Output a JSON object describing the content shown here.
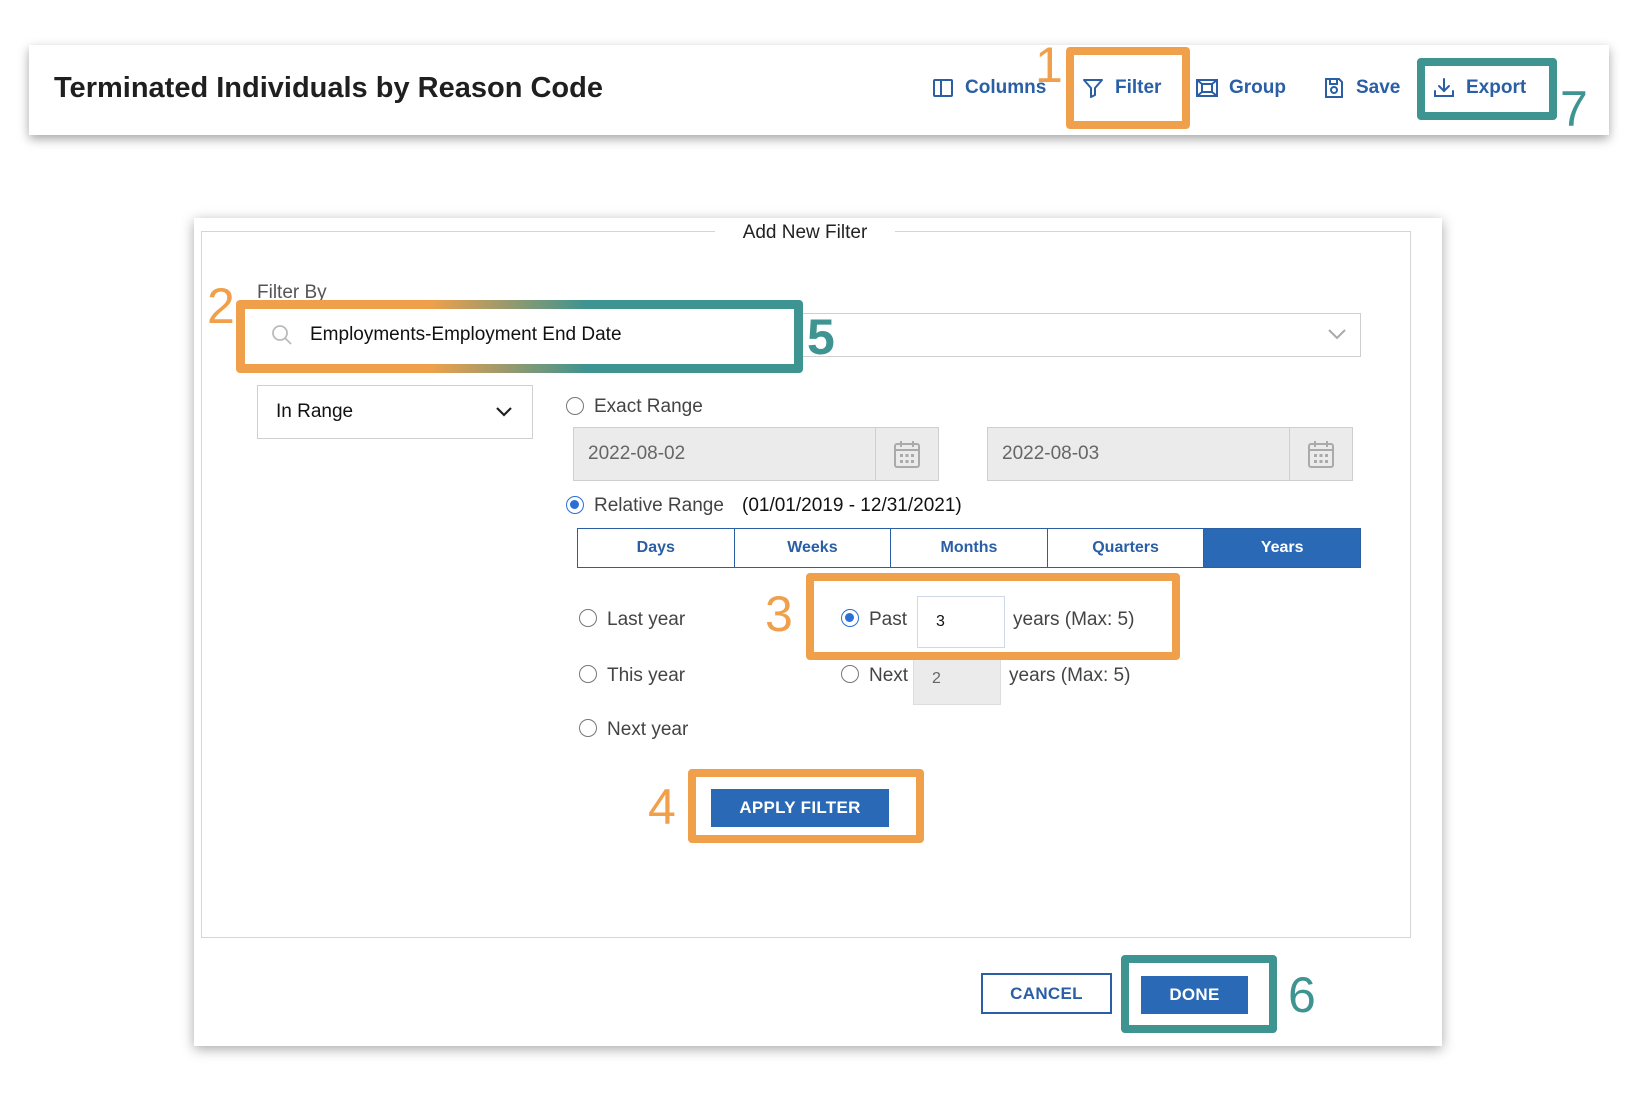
{
  "toolbar": {
    "title": "Terminated Individuals by Reason Code",
    "columns_label": "Columns",
    "filter_label": "Filter",
    "group_label": "Group",
    "save_label": "Save",
    "export_label": "Export"
  },
  "dialog": {
    "legend": "Add New Filter",
    "filter_by_label": "Filter By",
    "filter_by_value": "Employments-Employment End Date",
    "operator_value": "In Range",
    "exact_range_label": "Exact Range",
    "exact_start": "2022-08-02",
    "exact_end": "2022-08-03",
    "relative_range_label": "Relative Range",
    "relative_range_text": "(01/01/2019 - 12/31/2021)",
    "units": [
      "Days",
      "Weeks",
      "Months",
      "Quarters",
      "Years"
    ],
    "active_unit": "Years",
    "options": {
      "last_year": "Last year",
      "this_year": "This year",
      "next_year": "Next year"
    },
    "past_label": "Past",
    "past_value": "3",
    "past_suffix": "years (Max: 5)",
    "next_label": "Next",
    "next_value": "2",
    "next_suffix": "years (Max: 5)",
    "apply_label": "APPLY FILTER",
    "cancel_label": "CANCEL",
    "done_label": "DONE"
  },
  "annotations": {
    "n1": "1",
    "n2": "2",
    "n3": "3",
    "n4": "4",
    "n5": "5",
    "n6": "6",
    "n7": "7"
  },
  "colors": {
    "annotation_orange": "#f0a04b",
    "annotation_teal": "#3d9490",
    "primary_blue": "#2a69b5",
    "link_blue": "#2a5fa6"
  }
}
